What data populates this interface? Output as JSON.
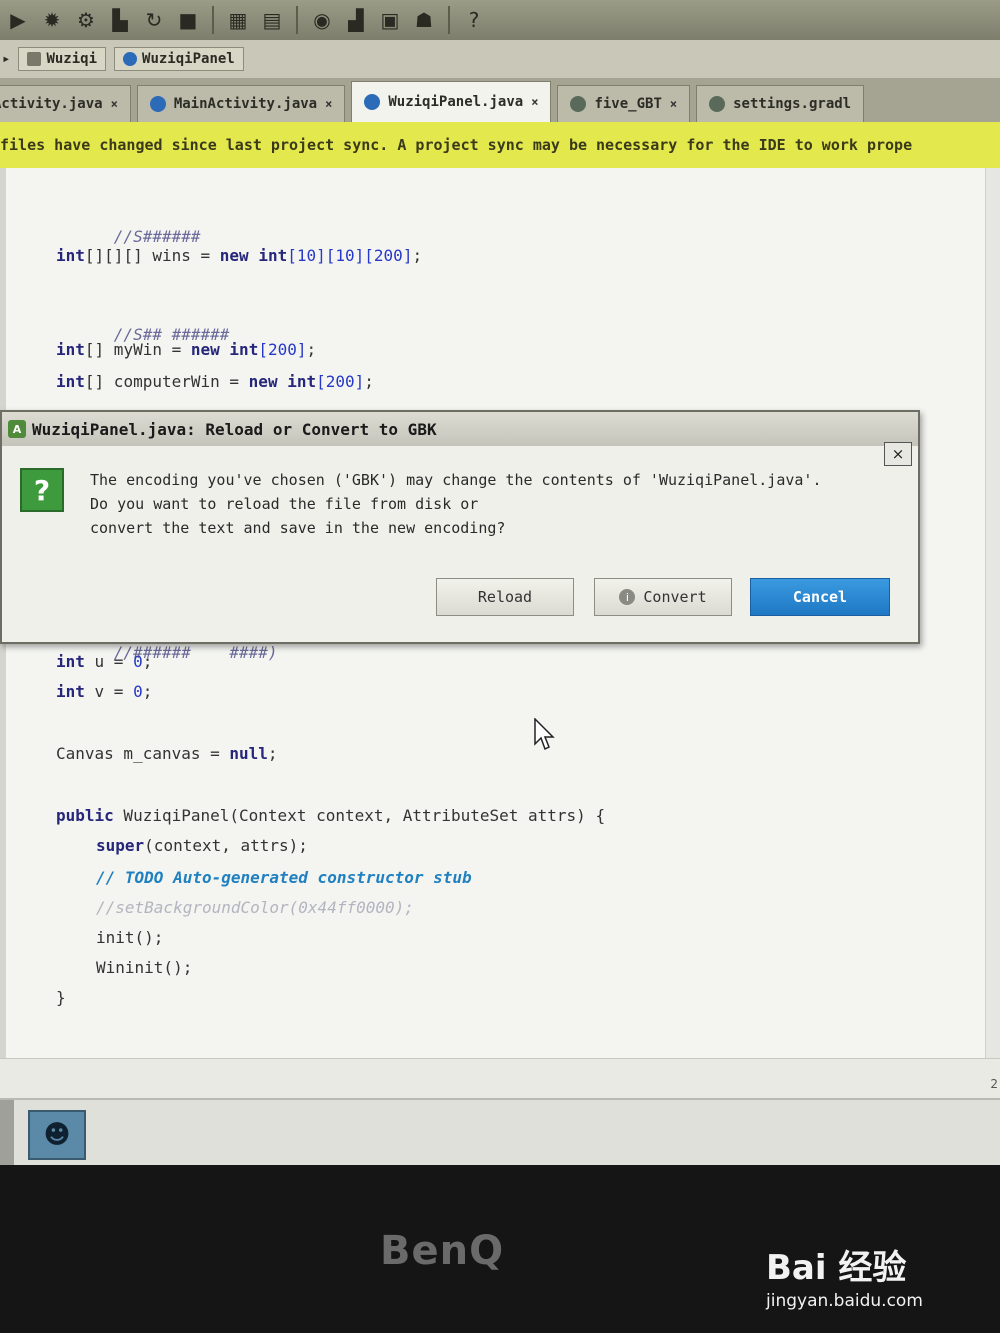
{
  "toolbar": {
    "icons": [
      "run-icon",
      "debug-icon",
      "settings-icon",
      "build-icon",
      "sync-icon",
      "stop-icon",
      "device-icon",
      "sdk-icon",
      "monitor-icon",
      "layout-icon",
      "android-icon",
      "help-icon"
    ],
    "help_glyph": "?"
  },
  "breadcrumb": {
    "items": [
      "Wuziqi",
      "WuziqiPanel"
    ]
  },
  "tabs": [
    {
      "label": "Activity.java",
      "close": "×"
    },
    {
      "label": "MainActivity.java",
      "close": "×"
    },
    {
      "label": "WuziqiPanel.java",
      "close": "×"
    },
    {
      "label": "five_GBT",
      "close": "×"
    },
    {
      "label": "settings.gradl",
      "close": ""
    }
  ],
  "banner": {
    "text": "files have changed since last project sync. A project sync may be necessary for the IDE to work prope"
  },
  "code": {
    "line1_comment": "//S######",
    "line2_kw": "int",
    "line2_rest_a": "[][][] wins = ",
    "line2_new": "new",
    "line2_int": "int",
    "line2_dims": "[10][10][200]",
    "line2_end": ";",
    "line3_comment": "//S## ######",
    "line4_kw": "int",
    "line4_rest": "[] myWin = ",
    "line4_new": "new",
    "line4_int": "int",
    "line4_num": "[200]",
    "line4_end": ";",
    "line5_kw": "int",
    "line5_rest": "[] computerWin = ",
    "line5_new": "new",
    "line5_int": "int",
    "line5_num": "[200]",
    "line5_end": ";",
    "line6_comment": "//######    ####)",
    "line7_kw": "int",
    "line7_rest": " u = ",
    "line7_num": "0",
    "line7_end": ";",
    "line8_kw": "int",
    "line8_rest": " v = ",
    "line8_num": "0",
    "line8_end": ";",
    "line9_type": "Canvas",
    "line9_rest": " m_canvas = ",
    "line9_null": "null",
    "line9_end": ";",
    "line10_kw": "public",
    "line10_rest": " WuziqiPanel(Context context, AttributeSet attrs) {",
    "line11_super": "super",
    "line11_rest": "(context, attrs);",
    "line12_todo": "// TODO Auto-generated constructor stub",
    "line13_faded": "//setBackgroundColor(0x44ff0000);",
    "line14": "init();",
    "line15": "Wininit();",
    "line16": "}",
    "right_gutter_number": "2"
  },
  "dialog": {
    "title": "WuziqiPanel.java: Reload or Convert to GBK",
    "close": "×",
    "message_line1": "The encoding you've chosen ('GBK') may change the contents of 'WuziqiPanel.java'.",
    "message_line2": "Do you want to reload the file from disk or",
    "message_line3": "convert the text and save in the new encoding?",
    "question_glyph": "?",
    "buttons": {
      "reload": "Reload",
      "convert": "Convert",
      "cancel": "Cancel"
    }
  },
  "monitor": {
    "brand": "BenQ"
  },
  "watermark": {
    "logo": "Bai 经验",
    "url": "jingyan.baidu.com"
  }
}
